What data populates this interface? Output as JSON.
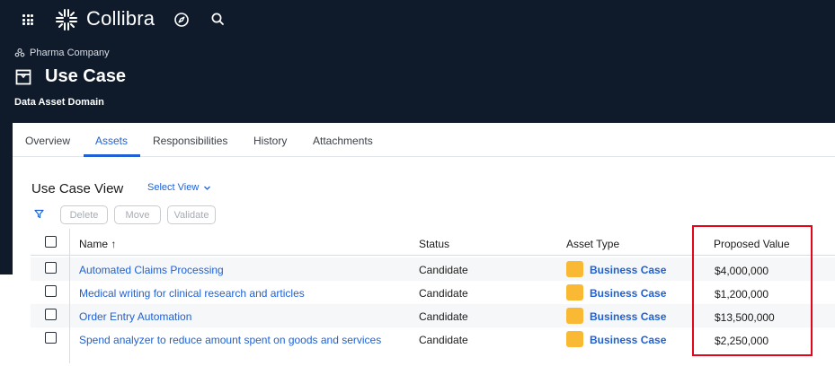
{
  "app": {
    "brand": "Collibra",
    "colors": {
      "header_bg": "#0f1b2b",
      "accent": "#1f61d4",
      "asset_type_chip": "#f9b934",
      "highlight": "#e3061a"
    }
  },
  "header": {
    "icons": [
      "apps-grid-icon",
      "compass-icon",
      "search-icon"
    ],
    "breadcrumb": "Pharma Company",
    "title": "Use Case",
    "subtitle": "Data Asset Domain"
  },
  "tabs": [
    {
      "label": "Overview",
      "active": false
    },
    {
      "label": "Assets",
      "active": true
    },
    {
      "label": "Responsibilities",
      "active": false
    },
    {
      "label": "History",
      "active": false
    },
    {
      "label": "Attachments",
      "active": false
    }
  ],
  "view": {
    "title": "Use Case View",
    "select_view_label": "Select View"
  },
  "toolbar": {
    "delete_label": "Delete",
    "move_label": "Move",
    "validate_label": "Validate"
  },
  "table": {
    "columns": {
      "name": "Name ↑",
      "status": "Status",
      "asset_type": "Asset Type",
      "proposed_value": "Proposed Value"
    },
    "rows": [
      {
        "name": "Automated Claims Processing",
        "status": "Candidate",
        "asset_type": "Business Case",
        "proposed_value": "$4,000,000"
      },
      {
        "name": "Medical writing for clinical research and articles",
        "status": "Candidate",
        "asset_type": "Business Case",
        "proposed_value": "$1,200,000"
      },
      {
        "name": "Order Entry Automation",
        "status": "Candidate",
        "asset_type": "Business Case",
        "proposed_value": "$13,500,000"
      },
      {
        "name": "Spend analyzer to reduce amount spent on goods and services",
        "status": "Candidate",
        "asset_type": "Business Case",
        "proposed_value": "$2,250,000"
      }
    ]
  }
}
